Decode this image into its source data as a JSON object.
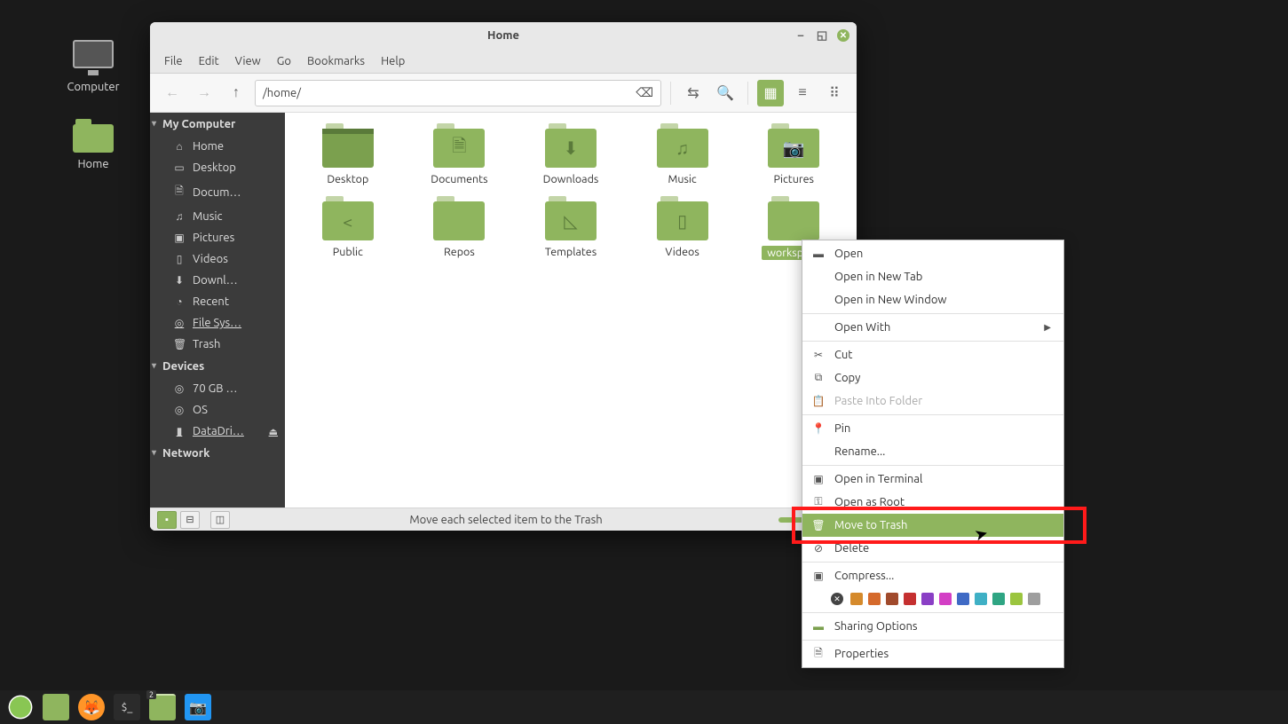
{
  "desktop": {
    "computer": "Computer",
    "home": "Home"
  },
  "window": {
    "title": "Home",
    "menu": [
      "File",
      "Edit",
      "View",
      "Go",
      "Bookmarks",
      "Help"
    ],
    "path": "/home/",
    "status": "Move each selected item to the Trash"
  },
  "sidebar": {
    "sec1": "My Computer",
    "items1": [
      "Home",
      "Desktop",
      "Docum…",
      "Music",
      "Pictures",
      "Videos",
      "Downl…",
      "Recent",
      "File Sys…",
      "Trash"
    ],
    "sec2": "Devices",
    "items2": [
      "70 GB …",
      "OS",
      "DataDri…"
    ],
    "sec3": "Network"
  },
  "folders": [
    {
      "name": "Desktop",
      "glyph": ""
    },
    {
      "name": "Documents",
      "glyph": "🗎"
    },
    {
      "name": "Downloads",
      "glyph": "⬇"
    },
    {
      "name": "Music",
      "glyph": "♫"
    },
    {
      "name": "Pictures",
      "glyph": "📷"
    },
    {
      "name": "Public",
      "glyph": "<"
    },
    {
      "name": "Repos",
      "glyph": ""
    },
    {
      "name": "Templates",
      "glyph": "◺"
    },
    {
      "name": "Videos",
      "glyph": "▯"
    },
    {
      "name": "workspace",
      "glyph": "",
      "selected": true
    }
  ],
  "ctx": {
    "open": "Open",
    "opentab": "Open in New Tab",
    "openwin": "Open in New Window",
    "openwith": "Open With",
    "cut": "Cut",
    "copy": "Copy",
    "paste": "Paste Into Folder",
    "pin": "Pin",
    "rename": "Rename...",
    "term": "Open in Terminal",
    "root": "Open as Root",
    "trash": "Move to Trash",
    "delete": "Delete",
    "compress": "Compress...",
    "sharing": "Sharing Options",
    "props": "Properties"
  },
  "colors": [
    "#d58a2c",
    "#d56a2c",
    "#a04a2c",
    "#c53030",
    "#8a3fc5",
    "#d33fc5",
    "#3f6ac5",
    "#3fb0c5",
    "#2fa583",
    "#9bc53f",
    "#9e9e9e"
  ],
  "taskbar": {
    "badge": "2"
  }
}
